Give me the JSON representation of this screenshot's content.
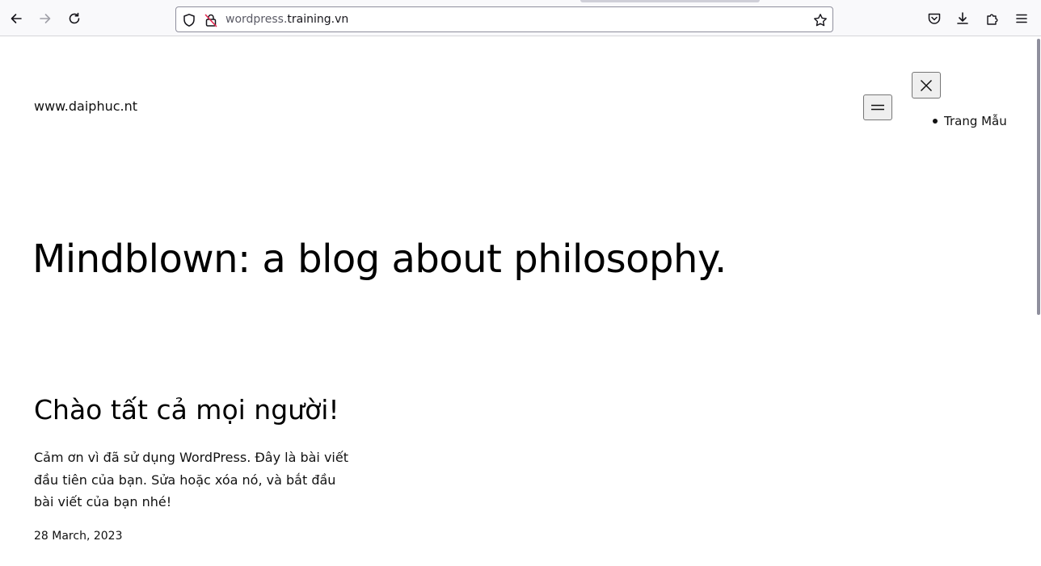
{
  "browser": {
    "url_prefix": "wordpress.",
    "url_host": "training.vn",
    "icons": {
      "back": "arrow-left-icon",
      "forward": "arrow-right-icon",
      "reload": "reload-icon",
      "tracking": "shield-icon",
      "insecure": "lock-insecure-icon",
      "bookmark": "star-icon",
      "pocket": "pocket-icon",
      "downloads": "download-icon",
      "extensions": "puzzle-icon",
      "menu": "hamburger-icon"
    }
  },
  "site": {
    "title": "www.daiphuc.nt",
    "menu_open_icon": "hamburger-icon",
    "menu_close_icon": "close-icon",
    "nav_items": [
      {
        "label": "Trang Mẫu"
      }
    ]
  },
  "hero": {
    "title": "Mindblown: a blog about philosophy."
  },
  "post": {
    "title": "Chào tất cả mọi người!",
    "excerpt_lines": [
      "Cảm ơn vì đã sử dụng WordPress. Đây là bài viết",
      "đầu tiên của bạn. Sửa hoặc xóa nó, và bắt đầu",
      "bài viết của bạn nhé!"
    ],
    "date": "28 March, 2023"
  },
  "colors": {
    "toolbar_bg": "#f9f9fb",
    "text": "#111111",
    "insecure_accent": "#e22850"
  }
}
